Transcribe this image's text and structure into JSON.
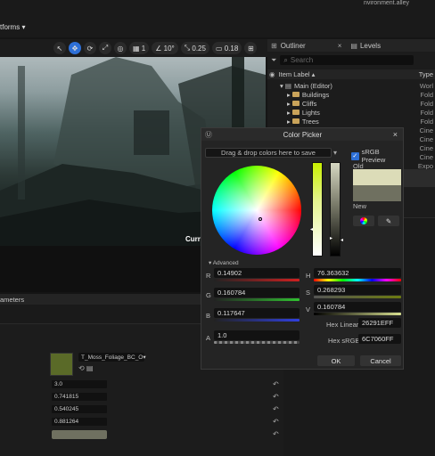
{
  "topbar": {
    "platforms_label": "tforms",
    "top_right_text": "nvironment.alley"
  },
  "viewport_toolbar": {
    "snap_value": "1",
    "angle_value": "10°",
    "scale_value": "0.25",
    "camera_value": "0.18"
  },
  "viewport": {
    "overlay_text": "Curre"
  },
  "outliner": {
    "tab_outliner": "Outliner",
    "tab_levels": "Levels",
    "search_placeholder": "Search",
    "col_item_label": "Item Label",
    "col_type": "Type",
    "items": [
      {
        "label": "Main (Editor)",
        "type": "Worl"
      },
      {
        "label": "Buildings",
        "type": "Fold"
      },
      {
        "label": "Cliffs",
        "type": "Fold"
      },
      {
        "label": "Lights",
        "type": "Fold"
      },
      {
        "label": "Trees",
        "type": "Fold"
      }
    ],
    "extra_types": [
      "Cine",
      "Cine",
      "Cine",
      "Cine",
      "Expo"
    ]
  },
  "color_picker": {
    "title": "Color Picker",
    "drop_hint": "Drag & drop colors here to save",
    "drop_hint_bg": "Drag & Drop",
    "srgb_label": "sRGB Preview",
    "old_label": "Old",
    "new_label": "New",
    "old_color": "#dcdcb8",
    "new_color": "#6f7060",
    "advanced_label": "Advanced",
    "r_label": "R",
    "r_value": "0.14902",
    "g_label": "G",
    "g_value": "0.160784",
    "b_label": "B",
    "b_value": "0.117647",
    "a_label": "A",
    "a_value": "1.0",
    "h_label": "H",
    "h_value": "76.363632",
    "s_label": "S",
    "s_value": "0.268293",
    "v_label": "V",
    "v_value": "0.160784",
    "hex_linear_label": "Hex Linear",
    "hex_linear_value": "26291EFF",
    "hex_srgb_label": "Hex sRGB",
    "hex_srgb_value": "6C7060FF",
    "ok_label": "OK",
    "cancel_label": "Cancel"
  },
  "details": {
    "parameters_label": "ameters",
    "texture_name": "T_Moss_Foliage_BC_O",
    "values": [
      "3.0",
      "0.741815",
      "0.540245",
      "0.881264"
    ]
  }
}
